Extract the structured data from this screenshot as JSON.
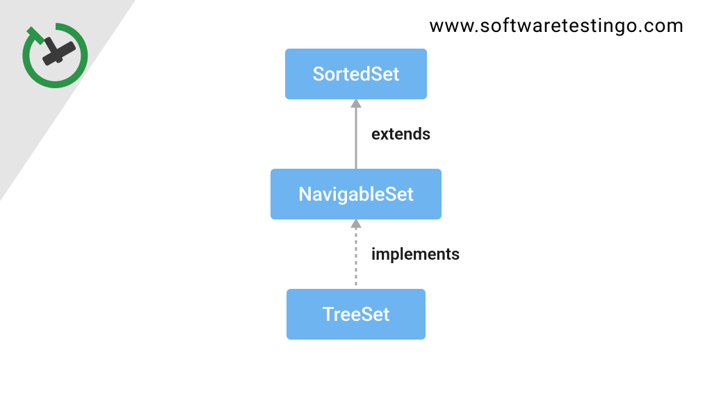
{
  "url": "www.softwaretestingo.com",
  "diagram": {
    "nodes": {
      "top": "SortedSet",
      "middle": "NavigableSet",
      "bottom": "TreeSet"
    },
    "connectors": {
      "upper_label": "extends",
      "lower_label": "implements"
    }
  },
  "colors": {
    "node_bg": "#6eb4f1",
    "node_text": "#ffffff",
    "arrow": "#a8a8a8",
    "triangle": "#e5e5e5",
    "logo_green": "#2a9448",
    "logo_dark": "#3a3a3a"
  }
}
